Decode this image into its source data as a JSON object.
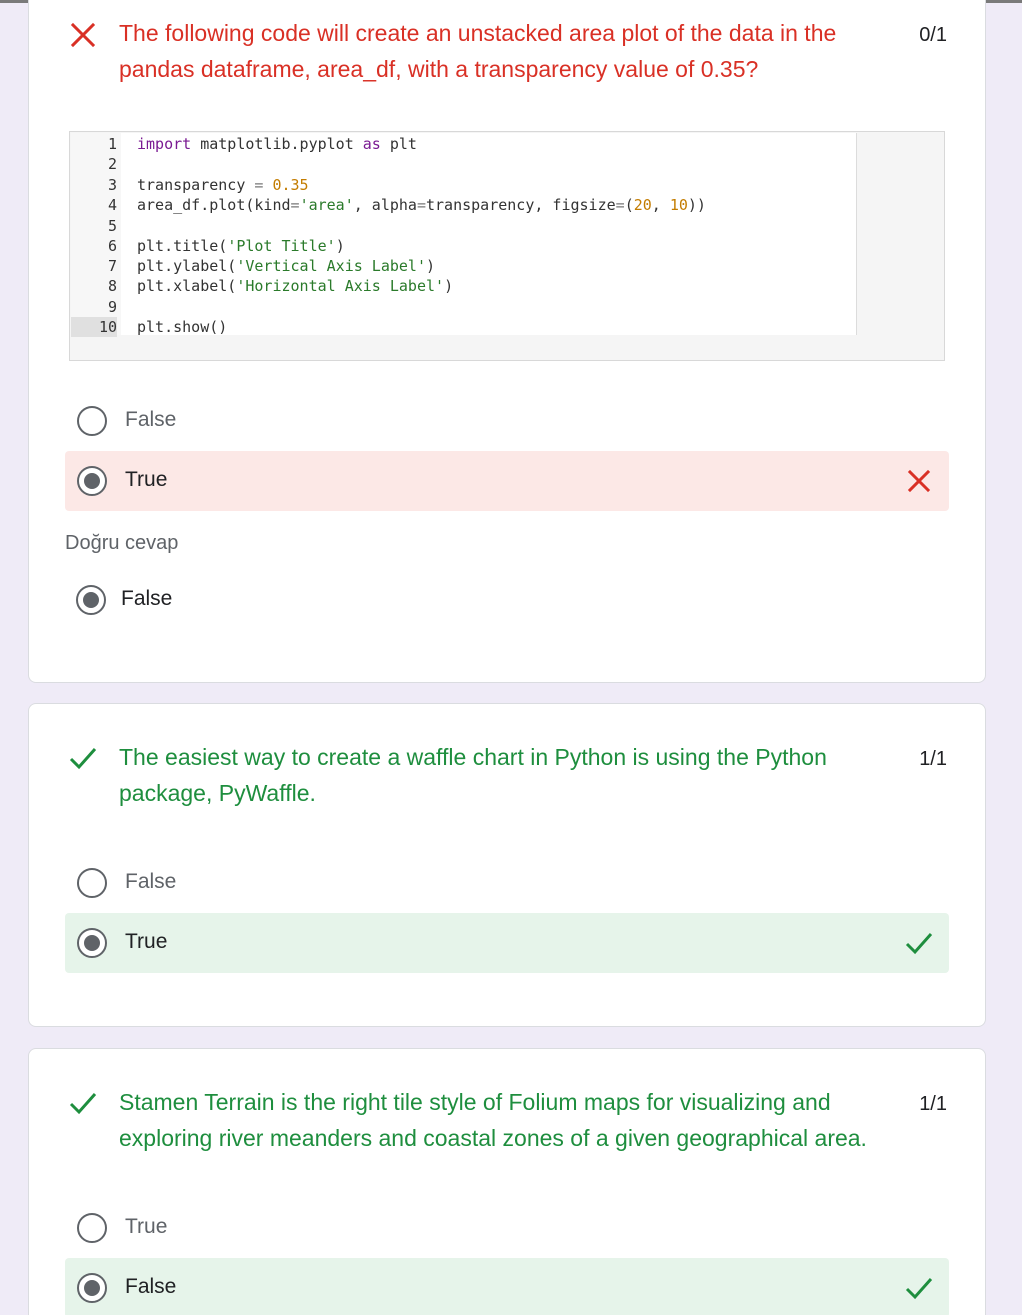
{
  "questions": [
    {
      "status": "wrong",
      "status_icon": "cross-icon",
      "text_line1": "The following code will create an unstacked area plot of the data in the",
      "text_line2": "pandas dataframe, area_df, with a transparency value of 0.35?",
      "score": "0/1",
      "code_lines": [
        {
          "n": "1",
          "text": "import matplotlib.pyplot as plt"
        },
        {
          "n": "2",
          "text": ""
        },
        {
          "n": "3",
          "text": "transparency = 0.35"
        },
        {
          "n": "4",
          "text": "area_df.plot(kind='area', alpha=transparency, figsize=(20, 10))"
        },
        {
          "n": "5",
          "text": ""
        },
        {
          "n": "6",
          "text": "plt.title('Plot Title')"
        },
        {
          "n": "7",
          "text": "plt.ylabel('Vertical Axis Label')"
        },
        {
          "n": "8",
          "text": "plt.xlabel('Horizontal Axis Label')"
        },
        {
          "n": "9",
          "text": ""
        },
        {
          "n": "10",
          "text": "plt.show()"
        }
      ],
      "options": [
        {
          "label": "False",
          "selected": false
        },
        {
          "label": "True",
          "selected": true,
          "mark": "cross-icon"
        }
      ],
      "correct_heading": "Doğru cevap",
      "correct_option": "False"
    },
    {
      "status": "correct",
      "status_icon": "check-icon",
      "text_line1": "The easiest way to create a waffle chart in Python is using the Python",
      "text_line2": "package, PyWaffle.",
      "score": "1/1",
      "options": [
        {
          "label": "False",
          "selected": false
        },
        {
          "label": "True",
          "selected": true,
          "mark": "check-icon"
        }
      ]
    },
    {
      "status": "correct",
      "status_icon": "check-icon",
      "text_line1": "Stamen Terrain is the right tile style of Folium maps for visualizing and",
      "text_line2": "exploring river meanders and coastal zones of a given geographical area.",
      "score": "1/1",
      "options": [
        {
          "label": "True",
          "selected": false
        },
        {
          "label": "False",
          "selected": true,
          "mark": "check-icon"
        }
      ]
    }
  ],
  "colors": {
    "wrong": "#d93025",
    "correct": "#1e8e3e",
    "page_bg": "#efebf7"
  }
}
